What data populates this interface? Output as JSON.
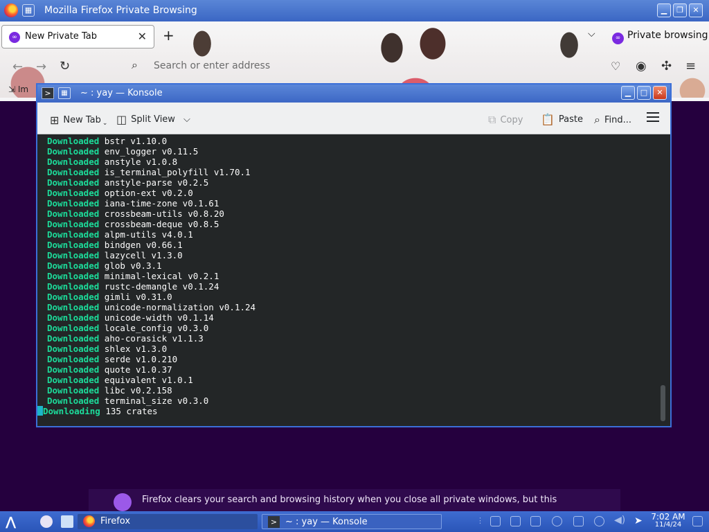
{
  "firefox": {
    "window_title": "Mozilla Firefox Private Browsing",
    "tab_label": "New Private Tab",
    "private_browsing_label": "Private browsing",
    "url_placeholder": "Search or enter address",
    "import_label": "Im",
    "private_message": "Firefox clears your search and browsing history when you close all private windows, but this"
  },
  "konsole": {
    "window_title": "~ : yay — Konsole",
    "toolbar": {
      "new_tab": "New Tab",
      "split_view": "Split View",
      "copy": "Copy",
      "paste": "Paste",
      "find": "Find..."
    },
    "terminal": {
      "lines": [
        {
          "status": "Downloaded",
          "text": "bstr v1.10.0"
        },
        {
          "status": "Downloaded",
          "text": "env_logger v0.11.5"
        },
        {
          "status": "Downloaded",
          "text": "anstyle v1.0.8"
        },
        {
          "status": "Downloaded",
          "text": "is_terminal_polyfill v1.70.1"
        },
        {
          "status": "Downloaded",
          "text": "anstyle-parse v0.2.5"
        },
        {
          "status": "Downloaded",
          "text": "option-ext v0.2.0"
        },
        {
          "status": "Downloaded",
          "text": "iana-time-zone v0.1.61"
        },
        {
          "status": "Downloaded",
          "text": "crossbeam-utils v0.8.20"
        },
        {
          "status": "Downloaded",
          "text": "crossbeam-deque v0.8.5"
        },
        {
          "status": "Downloaded",
          "text": "alpm-utils v4.0.1"
        },
        {
          "status": "Downloaded",
          "text": "bindgen v0.66.1"
        },
        {
          "status": "Downloaded",
          "text": "lazycell v1.3.0"
        },
        {
          "status": "Downloaded",
          "text": "glob v0.3.1"
        },
        {
          "status": "Downloaded",
          "text": "minimal-lexical v0.2.1"
        },
        {
          "status": "Downloaded",
          "text": "rustc-demangle v0.1.24"
        },
        {
          "status": "Downloaded",
          "text": "gimli v0.31.0"
        },
        {
          "status": "Downloaded",
          "text": "unicode-normalization v0.1.24"
        },
        {
          "status": "Downloaded",
          "text": "unicode-width v0.1.14"
        },
        {
          "status": "Downloaded",
          "text": "locale_config v0.3.0"
        },
        {
          "status": "Downloaded",
          "text": "aho-corasick v1.1.3"
        },
        {
          "status": "Downloaded",
          "text": "shlex v1.3.0"
        },
        {
          "status": "Downloaded",
          "text": "serde v1.0.210"
        },
        {
          "status": "Downloaded",
          "text": "quote v1.0.37"
        },
        {
          "status": "Downloaded",
          "text": "equivalent v1.0.1"
        },
        {
          "status": "Downloaded",
          "text": "libc v0.2.158"
        },
        {
          "status": "Downloaded",
          "text": "terminal_size v0.3.0"
        }
      ],
      "current_status": "Downloading",
      "current_text": "135 crates"
    }
  },
  "taskbar": {
    "tasks": [
      {
        "label": "Firefox",
        "icon": "firefox-icon"
      },
      {
        "label": "~ : yay — Konsole",
        "icon": "terminal-icon"
      }
    ],
    "clock_time": "7:02 AM",
    "clock_date": "11/4/24"
  },
  "colors": {
    "titlebar_blue": "#3c67c5",
    "private_purple": "#25003e",
    "terminal_bg": "#232627",
    "terminal_green": "#1cdc9a"
  }
}
